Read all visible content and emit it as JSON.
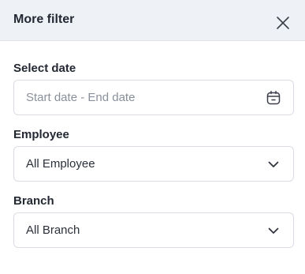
{
  "panel": {
    "title": "More filter",
    "close_icon": "close-icon"
  },
  "filters": {
    "date": {
      "label": "Select date",
      "placeholder": "Start date - End date",
      "icon": "calendar-icon"
    },
    "employee": {
      "label": "Employee",
      "value": "All Employee",
      "icon": "chevron-down-icon"
    },
    "branch": {
      "label": "Branch",
      "value": "All Branch",
      "icon": "chevron-down-icon"
    }
  },
  "colors": {
    "header_bg": "#eef1f6",
    "border": "#d9dde3",
    "placeholder": "#8a909a",
    "text": "#232833"
  }
}
